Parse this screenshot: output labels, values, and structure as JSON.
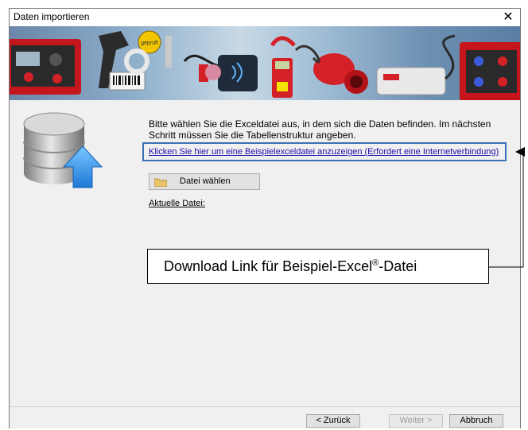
{
  "window": {
    "title": "Daten importieren",
    "close_symbol": "✕"
  },
  "main": {
    "instruction": "Bitte wählen Sie die Exceldatei aus, in dem sich die Daten befinden. Im nächsten Schritt müssen Sie die Tabellenstruktur angeben.",
    "example_link": "Klicken Sie hier um eine Beispielexceldatei anzuzeigen (Erfordert eine Internetverbindung)",
    "choose_file_label": "Datei wählen",
    "current_file_label": "Aktuelle Datei:"
  },
  "callout": {
    "text_before": "Download Link für Beispiel-Excel",
    "superscript": "®",
    "text_after": "-Datei"
  },
  "banner": {
    "badge_text": "geprüft"
  },
  "footer": {
    "back_label": "< Zurück",
    "next_label": "Weiter >",
    "cancel_label": "Abbruch"
  },
  "colors": {
    "link": "#1a0dab",
    "highlight_border": "#3a6fb5",
    "device_red": "#d42027"
  },
  "icons": [
    "database-upload-icon",
    "folder-icon",
    "close-icon",
    "arrow-left-icon"
  ]
}
